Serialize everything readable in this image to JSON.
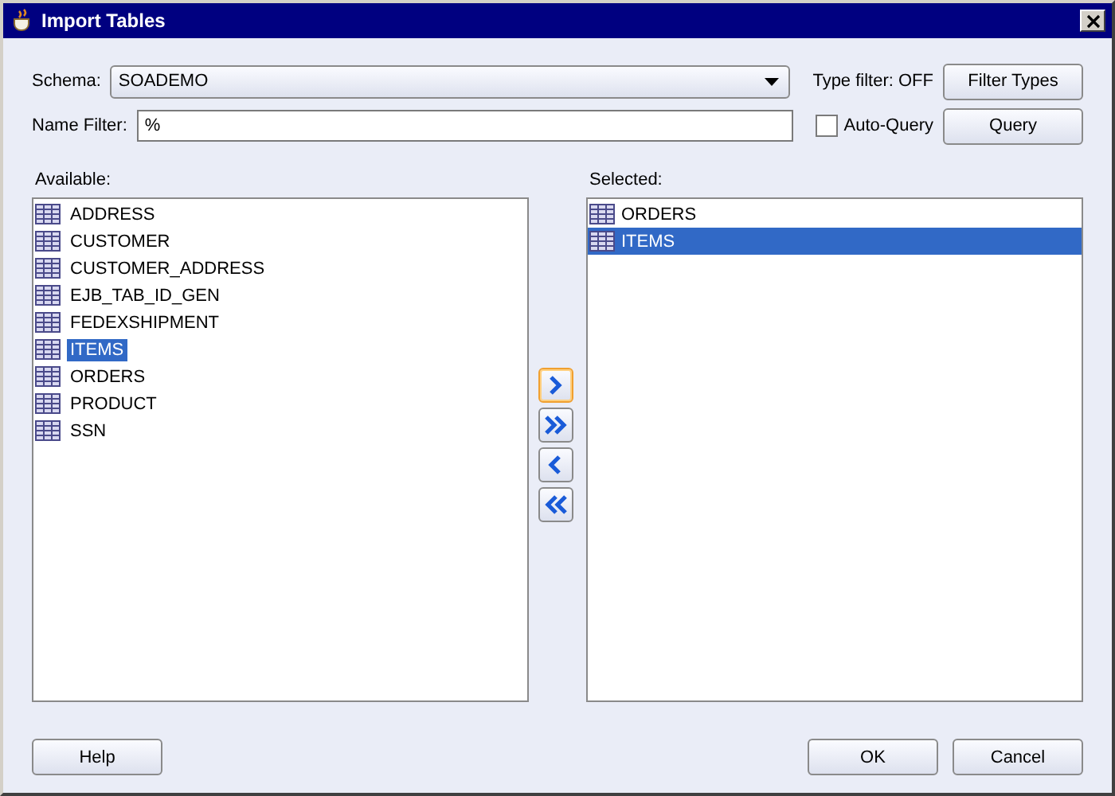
{
  "window": {
    "title": "Import Tables"
  },
  "schema": {
    "label": "Schema:",
    "value": "SOADEMO"
  },
  "type_filter": {
    "label": "Type filter: OFF",
    "button": "Filter Types"
  },
  "name_filter": {
    "label": "Name Filter:",
    "value": "%"
  },
  "auto_query": {
    "label": "Auto-Query",
    "checked": false
  },
  "query_button": "Query",
  "available": {
    "label": "Available:",
    "items": [
      {
        "name": "ADDRESS",
        "selected": false
      },
      {
        "name": "CUSTOMER",
        "selected": false
      },
      {
        "name": "CUSTOMER_ADDRESS",
        "selected": false
      },
      {
        "name": "EJB_TAB_ID_GEN",
        "selected": false
      },
      {
        "name": "FEDEXSHIPMENT",
        "selected": false
      },
      {
        "name": "ITEMS",
        "selected": true
      },
      {
        "name": "ORDERS",
        "selected": false
      },
      {
        "name": "PRODUCT",
        "selected": false
      },
      {
        "name": "SSN",
        "selected": false
      }
    ]
  },
  "shuttle": [
    {
      "kind": "add",
      "focused": true
    },
    {
      "kind": "add_all",
      "focused": false
    },
    {
      "kind": "remove",
      "focused": false
    },
    {
      "kind": "remove_all",
      "focused": false
    }
  ],
  "selected": {
    "label": "Selected:",
    "items": [
      {
        "name": "ORDERS",
        "selected": false
      },
      {
        "name": "ITEMS",
        "selected": true
      }
    ]
  },
  "buttons": [
    "Help",
    "OK",
    "Cancel"
  ]
}
